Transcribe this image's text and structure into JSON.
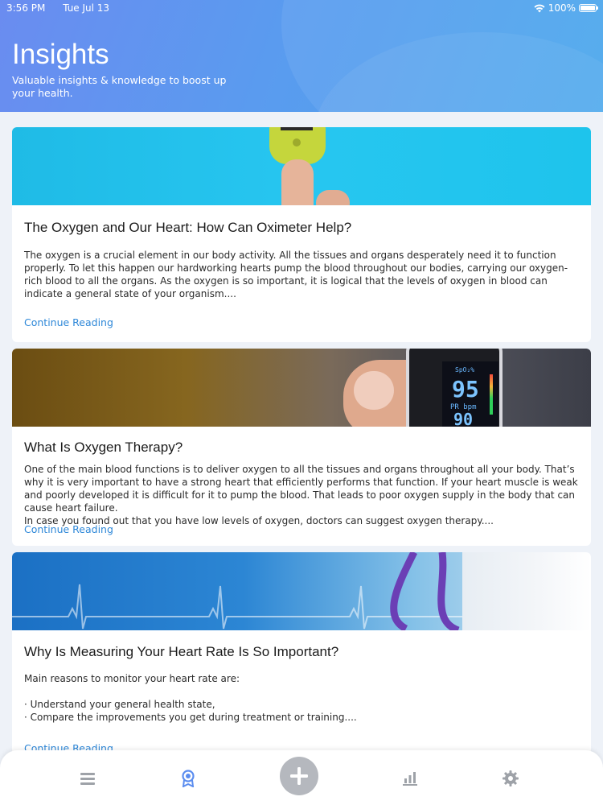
{
  "status_bar": {
    "time": "3:56 PM",
    "date": "Tue Jul 13",
    "battery": "100%"
  },
  "header": {
    "title": "Insights",
    "subtitle": "Valuable insights & knowledge to boost up your health."
  },
  "articles": [
    {
      "title": "The Oxygen and Our Heart: How Can Oximeter Help?",
      "text": "The oxygen is a crucial element in our body activity. All the tissues and organs desperately need it to function properly. To let this happen our hardworking hearts pump the blood throughout our bodies, carrying our oxygen-rich blood to all the organs. As the oxygen is so important, it is logical that the levels of oxygen in blood can indicate a general state of your organism....",
      "link": "Continue Reading"
    },
    {
      "title": "What Is Oxygen Therapy?",
      "text": "One of the main blood functions is to deliver oxygen to all the tissues and organs throughout all your body. That’s why it is very important to have a strong heart that efficiently performs that function. If your heart muscle is weak and poorly developed it is difficult for it to pump the blood. That leads to poor oxygen supply in the body that can cause heart failure.\nIn case you found out that you have low levels of oxygen, doctors can suggest oxygen therapy....",
      "link": "Continue Reading",
      "image_text": {
        "spo2_label": "SpO₂%",
        "spo2_value": "95",
        "pr_label": "PR bpm",
        "pr_value": "90"
      }
    },
    {
      "title": "Why Is Measuring Your Heart Rate Is So Important?",
      "text": "Main reasons to monitor your heart rate are:\n\n· Understand your general health state,\n· Compare the improvements you get during treatment or training....",
      "link": "Continue Reading"
    }
  ],
  "tabbar": {
    "items": [
      "menu-icon",
      "award-icon",
      "plus-icon",
      "bar-chart-icon",
      "gear-icon"
    ],
    "active": "award-icon",
    "active_color": "#5b8def",
    "inactive_color": "#9ea2a8"
  },
  "colors": {
    "link": "#2d87d8",
    "header_gradient_start": "#6a8cf0",
    "header_gradient_end": "#4aa7ec"
  }
}
